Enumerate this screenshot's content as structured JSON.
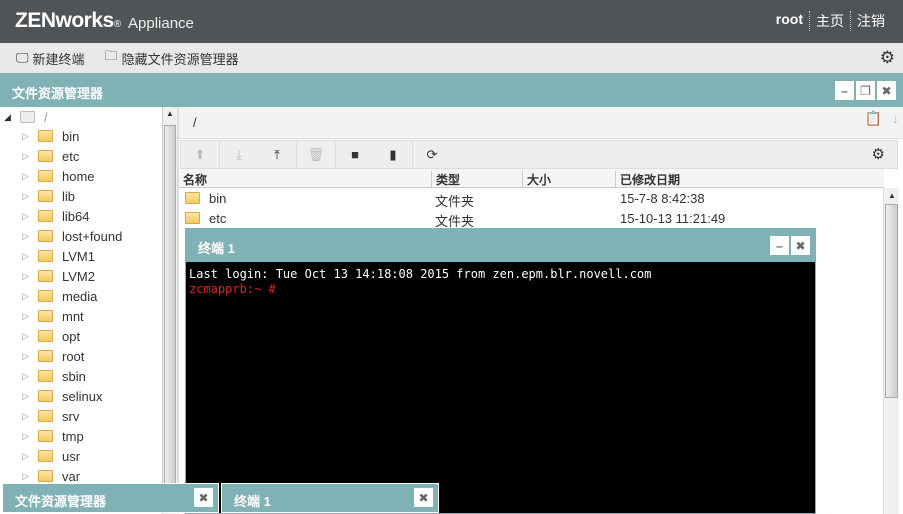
{
  "header": {
    "brand": "ZENworks",
    "reg": "®",
    "product": "Appliance",
    "user": "root",
    "nav": [
      "主页",
      "注销"
    ]
  },
  "toolbar": {
    "new_terminal": "新建终端",
    "hide_explorer": "隐藏文件资源管理器"
  },
  "explorer": {
    "title": "文件资源管理器",
    "path": "/",
    "tree": {
      "root": "/",
      "items": [
        "bin",
        "etc",
        "home",
        "lib",
        "lib64",
        "lost+found",
        "LVM1",
        "LVM2",
        "media",
        "mnt",
        "opt",
        "root",
        "sbin",
        "selinux",
        "srv",
        "tmp",
        "usr",
        "var"
      ]
    },
    "columns": [
      "名称",
      "类型",
      "大小",
      "已修改日期"
    ],
    "rows": [
      {
        "name": "bin",
        "type": "文件夹",
        "size": "",
        "date": "15-7-8 8:42:38"
      },
      {
        "name": "etc",
        "type": "文件夹",
        "size": "",
        "date": "15-10-13 11:21:49"
      }
    ]
  },
  "terminal": {
    "title": "终端 1",
    "line1": "Last login: Tue Oct 13 14:18:08 2015 from zen.epm.blr.novell.com",
    "prompt": "zcmapprb:~ #"
  },
  "taskbar": [
    {
      "label": "文件资源管理器"
    },
    {
      "label": "终端 1"
    }
  ],
  "colors": {
    "header": "#505456",
    "accent": "#80b1b5",
    "prompt": "#e0261f"
  }
}
